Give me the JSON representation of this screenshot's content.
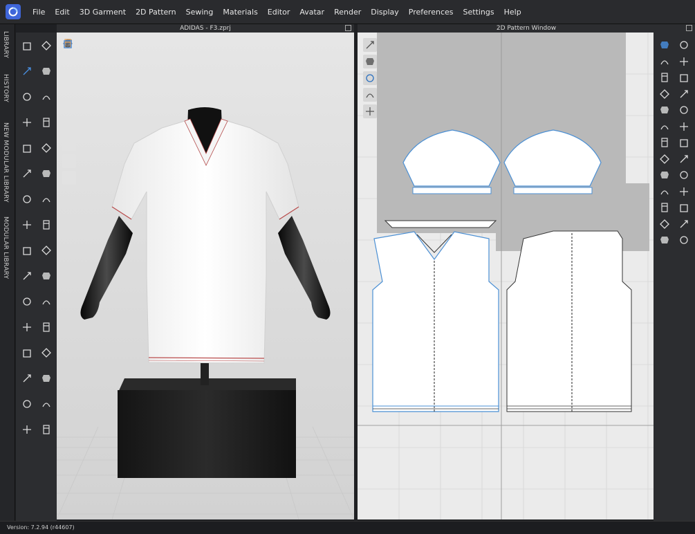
{
  "menu": [
    "File",
    "Edit",
    "3D Garment",
    "2D Pattern",
    "Sewing",
    "Materials",
    "Editor",
    "Avatar",
    "Render",
    "Display",
    "Preferences",
    "Settings",
    "Help"
  ],
  "side_tabs": [
    "LIBRARY",
    "HISTORY",
    "NEW MODULAR LIBRARY",
    "MODULAR LIBRARY"
  ],
  "panel_3d": {
    "title": "ADIDAS - F3.zprj"
  },
  "panel_2d": {
    "title": "2D Pattern Window"
  },
  "status": {
    "version": "Version: 7.2.94 (r44607)"
  },
  "colors": {
    "accent": "#4a90e2",
    "menubar": "#2a2b2e",
    "toolbar": "#2c2d30",
    "pattern_outline": "#4a8fd4",
    "stitch": "#1a1a1a"
  },
  "icons": {
    "left_toolbar": [
      "select-icon",
      "transform-icon",
      "move-icon",
      "pin-icon",
      "fold-icon",
      "segment-icon",
      "garment-icon",
      "strengthen-icon",
      "steam-icon",
      "sewing-icon",
      "select-mesh-icon",
      "puckering-icon",
      "fit-icon",
      "skin-icon",
      "shrinkage-icon",
      "button-icon",
      "buttonhole-icon",
      "zipper-icon",
      "piping-icon",
      "trim-icon",
      "measure-icon",
      "pleat-icon",
      "snap-icon",
      "fabric-icon",
      "texture-icon",
      "avatar-icon",
      "pose-icon",
      "fold-arrangement-icon",
      "tape-icon",
      "shape-icon",
      "line-icon",
      "arrange-icon"
    ],
    "view3d_tools": [
      "shaded-view-icon",
      "avatar-visibility-icon",
      "skeleton-icon",
      "xray-icon",
      "arrangement-points-icon",
      "fabric-view-icon",
      "texture-view-icon",
      "avatar-color-icon",
      "env-icon"
    ],
    "view2d_tools": [
      "line-icon",
      "fabric-icon",
      "info-icon",
      "texture-icon",
      "garment-view-icon"
    ],
    "right_toolbar": [
      "transform-pattern-icon",
      "edit-pattern-icon",
      "edit-curvature-icon",
      "curve-point-icon",
      "add-point-icon",
      "polygon-icon",
      "rectangle-icon",
      "circle-icon",
      "internal-polygon-icon",
      "internal-rectangle-icon",
      "dart-icon",
      "slash-icon",
      "seam-allowance-icon",
      "notch-icon",
      "text-annotation-icon",
      "text-icon",
      "grading-icon",
      "baseline-icon",
      "zigzag-icon",
      "ruler-icon",
      "trace-icon",
      "fold-icon",
      "hem-icon",
      "pleat-icon",
      "pin-icon",
      "avatar-pose-icon"
    ]
  }
}
